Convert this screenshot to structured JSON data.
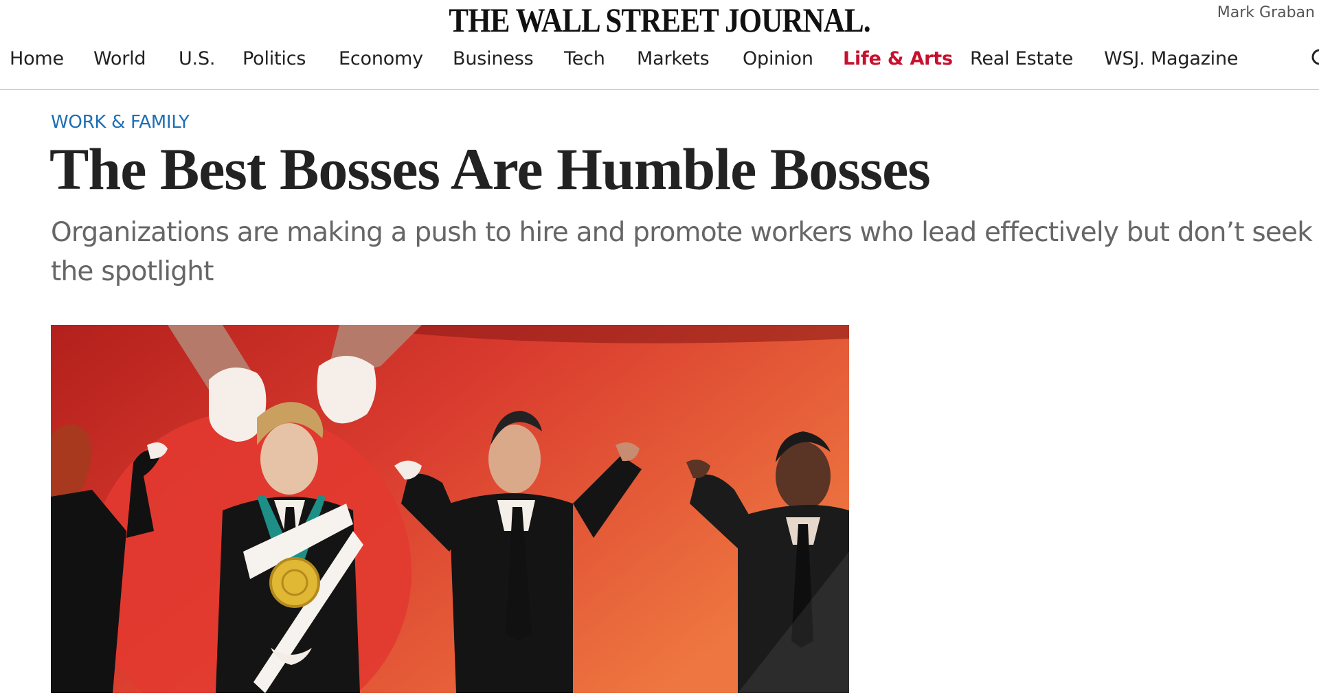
{
  "masthead": {
    "logo": "THE WALL STREET JOURNAL.",
    "user_name": "Mark Graban"
  },
  "nav": {
    "items": [
      {
        "label": "Home"
      },
      {
        "label": "World"
      },
      {
        "label": "U.S."
      },
      {
        "label": "Politics"
      },
      {
        "label": "Economy"
      },
      {
        "label": "Business"
      },
      {
        "label": "Tech"
      },
      {
        "label": "Markets"
      },
      {
        "label": "Opinion"
      },
      {
        "label": "Life & Arts",
        "active": true
      },
      {
        "label": "Real Estate"
      },
      {
        "label": "WSJ. Magazine"
      }
    ],
    "search_icon": "search-icon"
  },
  "article": {
    "kicker": "WORK & FAMILY",
    "headline": "The Best Bosses Are Humble Bosses",
    "dek": "Organizations are making a push to hire and promote workers who lead effectively but don’t seek the spotlight"
  },
  "hero": {
    "image_name": "illustration-humble-boss-medal"
  },
  "colors": {
    "active_nav": "#c8102e",
    "kicker": "#1d6fb5",
    "hero_red": "#d93a2e"
  }
}
